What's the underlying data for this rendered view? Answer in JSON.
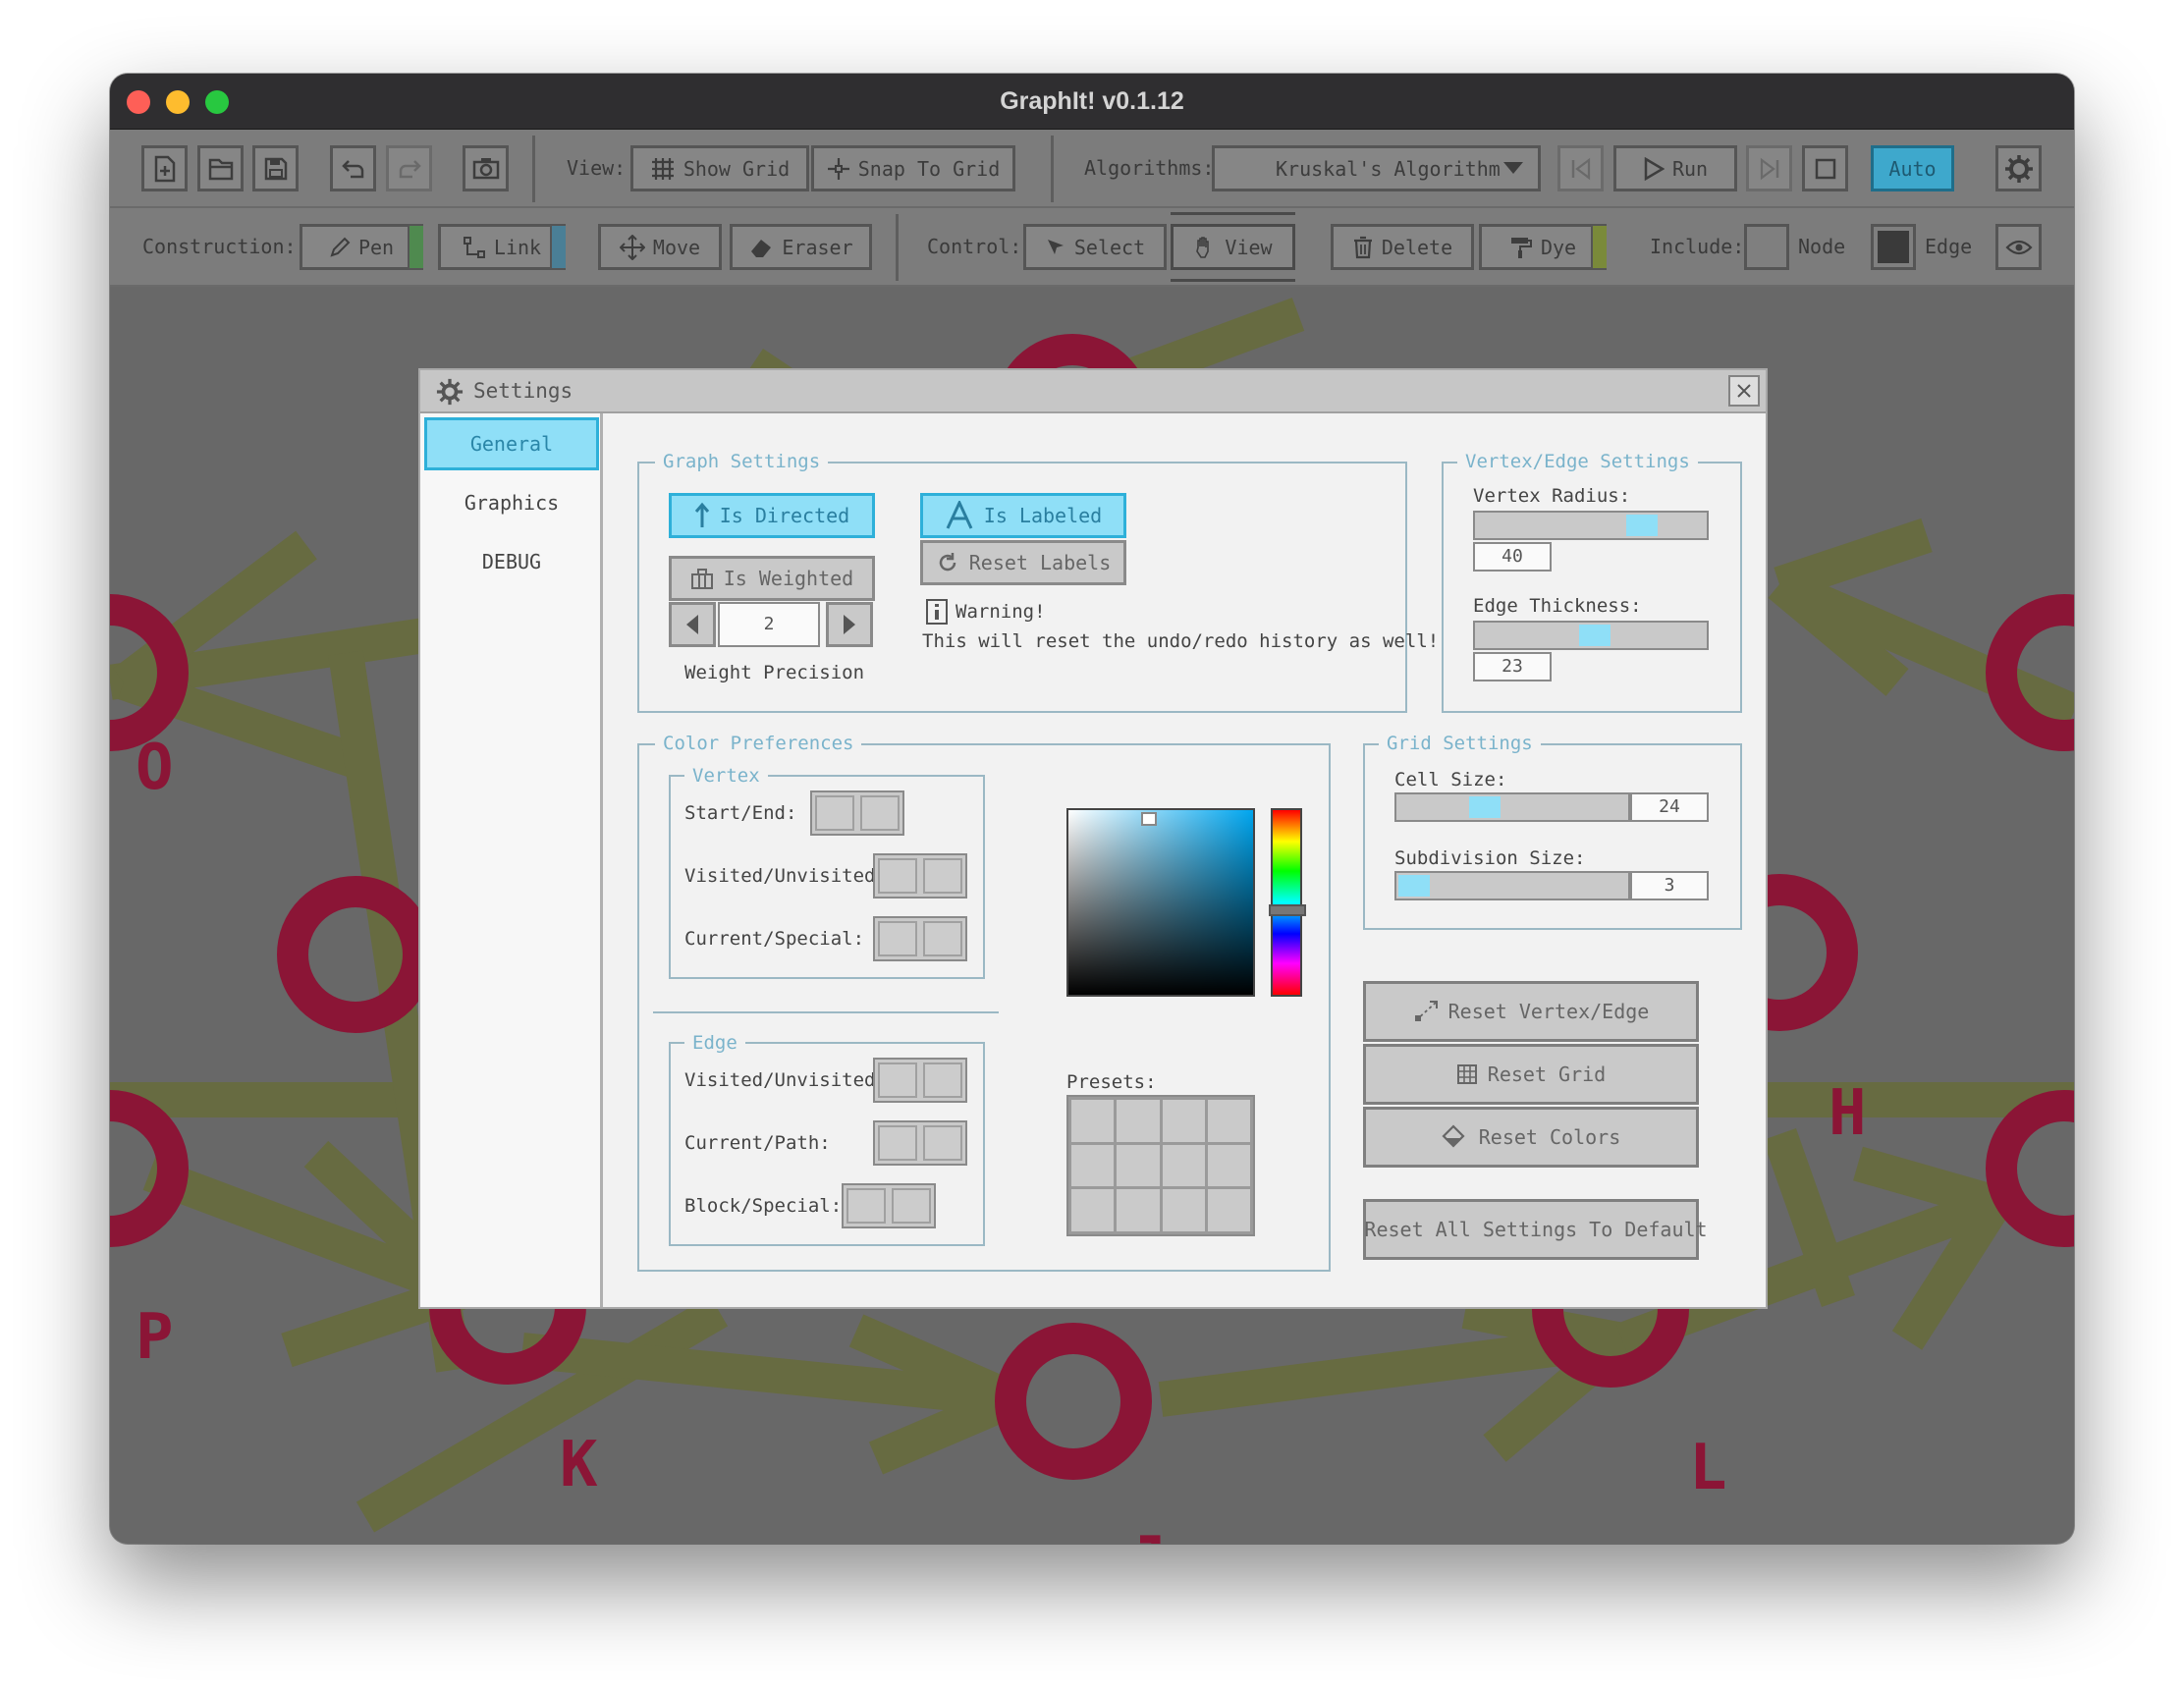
{
  "window": {
    "title": "GraphIt! v0.1.12",
    "traffic_lights": {
      "close": "#fe5f57",
      "minimize": "#febc2e",
      "zoom": "#28c840"
    }
  },
  "toolbar1": {
    "file_buttons": [
      "new-file-icon",
      "open-file-icon",
      "save-file-icon"
    ],
    "undo_icon": "undo-icon",
    "redo_icon": "redo-icon",
    "screenshot_icon": "camera-icon",
    "view_label": "View:",
    "show_grid": "Show Grid",
    "snap_to_grid": "Snap To Grid",
    "algorithms_label": "Algorithms:",
    "algorithm_selected": "Kruskal's Algorithm",
    "run": "Run",
    "auto": "Auto"
  },
  "toolbar2": {
    "construction_label": "Construction:",
    "pen": "Pen",
    "link": "Link",
    "move": "Move",
    "eraser": "Eraser",
    "control_label": "Control:",
    "select": "Select",
    "view": "View",
    "delete": "Delete",
    "dye": "Dye",
    "include_label": "Include:",
    "node": "Node",
    "edge": "Edge",
    "pen_color": "#4f8a4f",
    "link_color": "#4a7f96",
    "dye_color": "#7a8a3a"
  },
  "canvas": {
    "vertex_labels": [
      "O",
      "P",
      "K",
      "J",
      "L",
      "H"
    ],
    "vertex_color": "#9a0a32",
    "edge_color": "#6e7340"
  },
  "settings": {
    "title": "Settings",
    "tabs": [
      "General",
      "Graphics",
      "DEBUG"
    ],
    "graph_settings": {
      "title": "Graph Settings",
      "is_directed": "Is Directed",
      "is_labeled": "Is Labeled",
      "is_weighted": "Is Weighted",
      "reset_labels": "Reset Labels",
      "weight_precision_value": "2",
      "weight_precision_label": "Weight Precision",
      "warning_title": "Warning!",
      "warning_text": "This will reset the undo/redo history as well!"
    },
    "vertex_edge_settings": {
      "title": "Vertex/Edge Settings",
      "vertex_radius_label": "Vertex Radius:",
      "vertex_radius_value": "40",
      "edge_thickness_label": "Edge Thickness:",
      "edge_thickness_value": "23"
    },
    "color_preferences": {
      "title": "Color Preferences",
      "vertex_title": "Vertex",
      "start_end": "Start/End:",
      "visited_unvisited": "Visited/Unvisited:",
      "current_special": "Current/Special:",
      "edge_title": "Edge",
      "edge_visited_unvisited": "Visited/Unvisited:",
      "current_path": "Current/Path:",
      "block_special": "Block/Special:",
      "presets": "Presets:"
    },
    "grid_settings": {
      "title": "Grid Settings",
      "cell_size_label": "Cell Size:",
      "cell_size_value": "24",
      "subdivision_label": "Subdivision Size:",
      "subdivision_value": "3"
    },
    "buttons": {
      "reset_vertex_edge": "Reset Vertex/Edge",
      "reset_grid": "Reset Grid",
      "reset_colors": "Reset Colors",
      "reset_all": "Reset All Settings To Default"
    },
    "accent": "#8fdff7"
  }
}
